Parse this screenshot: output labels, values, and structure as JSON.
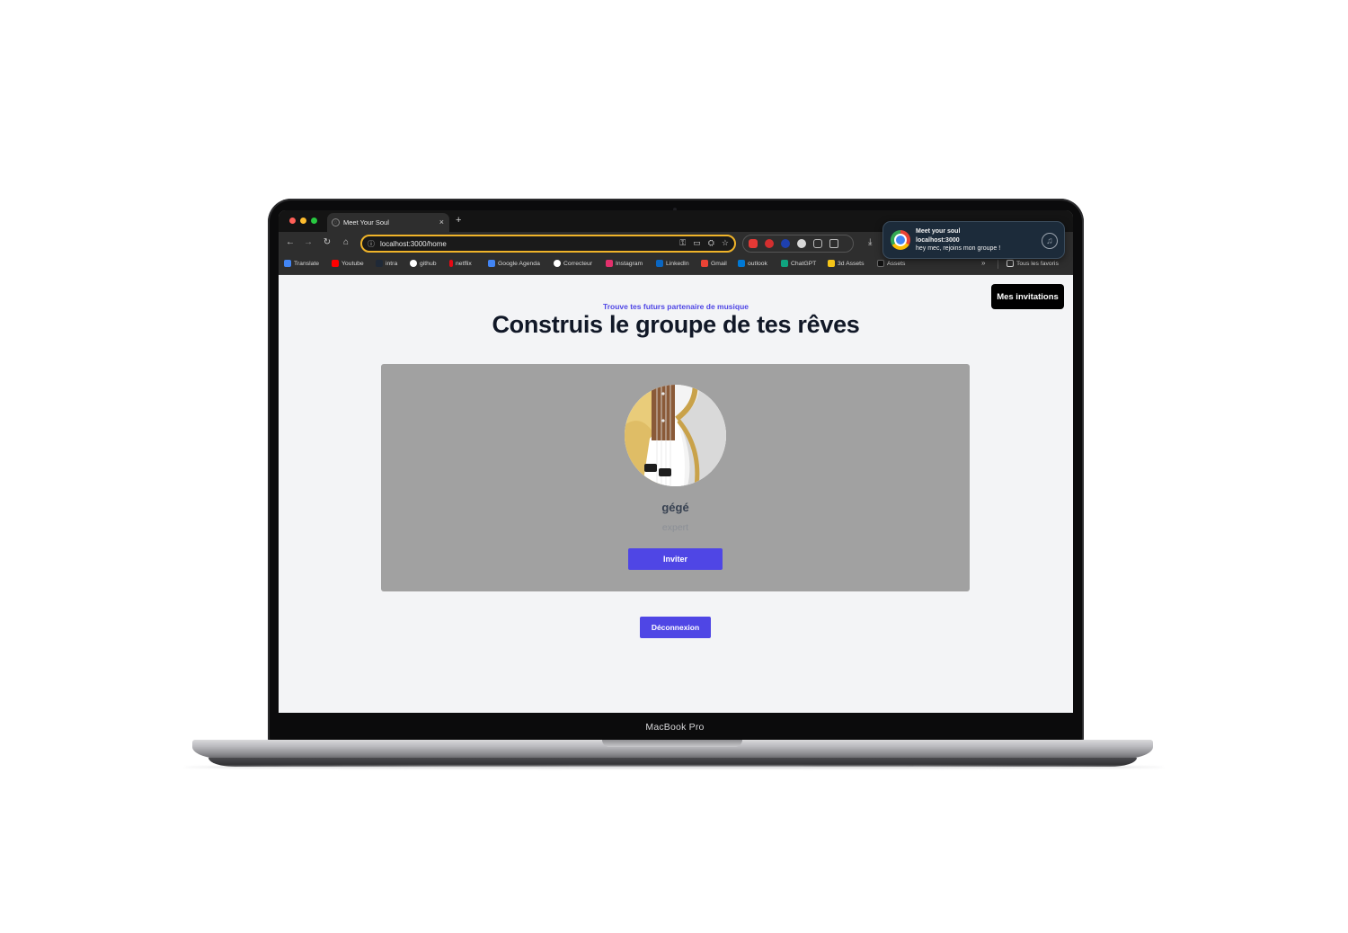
{
  "device": {
    "model_label": "MacBook Pro"
  },
  "browser": {
    "tab": {
      "title": "Meet Your Soul",
      "close": "×"
    },
    "new_tab": "+",
    "address": "localhost:3000/home",
    "bookmarks": [
      {
        "label": "Translate",
        "color": "#4285f4"
      },
      {
        "label": "Youtube",
        "color": "#ff0000"
      },
      {
        "label": "intra",
        "color": "#1f2937"
      },
      {
        "label": "github",
        "color": "#ffffff"
      },
      {
        "label": "netflix",
        "color": "#e50914"
      },
      {
        "label": "Google Agenda",
        "color": "#4285f4"
      },
      {
        "label": "Correcteur",
        "color": "#ffffff"
      },
      {
        "label": "Instagram",
        "color": "#e1306c"
      },
      {
        "label": "LinkedIn",
        "color": "#0a66c2"
      },
      {
        "label": "Gmail",
        "color": "#ea4335"
      },
      {
        "label": "outlook",
        "color": "#0078d4"
      },
      {
        "label": "ChatGPT",
        "color": "#10a37f"
      },
      {
        "label": "3d Assets",
        "color": "#f5c518"
      },
      {
        "label": "Assets",
        "color": "#1a1a1a"
      }
    ],
    "bookmarks_more": "»",
    "all_bookmarks": "Tous les favoris"
  },
  "notification": {
    "title": "Meet your soul",
    "origin": "localhost:3000",
    "message": "hey mec, rejoins mon groupe !"
  },
  "page": {
    "invitations_button": "Mes invitations",
    "eyebrow": "Trouve tes futurs partenaire de musique",
    "headline": "Construis le groupe de tes rêves",
    "card": {
      "name": "gégé",
      "level": "expert",
      "invite_button": "Inviter"
    },
    "logout_button": "Déconnexion"
  },
  "colors": {
    "accent": "#4f46e5",
    "card_bg": "#a1a1a1",
    "page_bg": "#f3f4f6",
    "omnibox_focus": "#f0b429"
  }
}
